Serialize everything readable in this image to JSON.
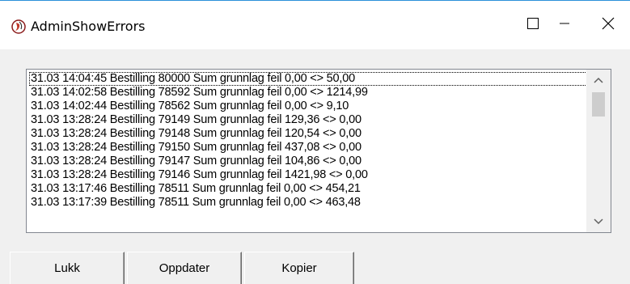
{
  "window": {
    "title": "AdminShowErrors"
  },
  "errors": {
    "rows": [
      "31.03 14:04:45 Bestilling 80000 Sum grunnlag feil 0,00 <> 50,00",
      "31.03 14:02:58 Bestilling 78592 Sum grunnlag feil 0,00 <> 1214,99",
      "31.03 14:02:44 Bestilling 78562 Sum grunnlag feil 0,00 <> 9,10",
      "31.03 13:28:24 Bestilling 79149 Sum grunnlag feil 129,36 <> 0,00",
      "31.03 13:28:24 Bestilling 79148 Sum grunnlag feil 120,54 <> 0,00",
      "31.03 13:28:24 Bestilling 79150 Sum grunnlag feil 437,08 <> 0,00",
      "31.03 13:28:24 Bestilling 79147 Sum grunnlag feil 104,86 <> 0,00",
      "31.03 13:28:24 Bestilling 79146 Sum grunnlag feil 1421,98 <> 0,00",
      "31.03 13:17:46 Bestilling 78511 Sum grunnlag feil 0,00 <> 454,21",
      "31.03 13:17:39 Bestilling 78511 Sum grunnlag feil 0,00 <> 463,48"
    ]
  },
  "buttons": {
    "close_label": "Lukk",
    "refresh_label": "Oppdater",
    "copy_label": "Kopier"
  },
  "icons": {
    "app": "app-icon",
    "minimize": "minimize-icon",
    "maximize": "maximize-icon",
    "close": "close-icon",
    "scroll_up": "chevron-up-icon",
    "scroll_down": "chevron-down-icon"
  }
}
